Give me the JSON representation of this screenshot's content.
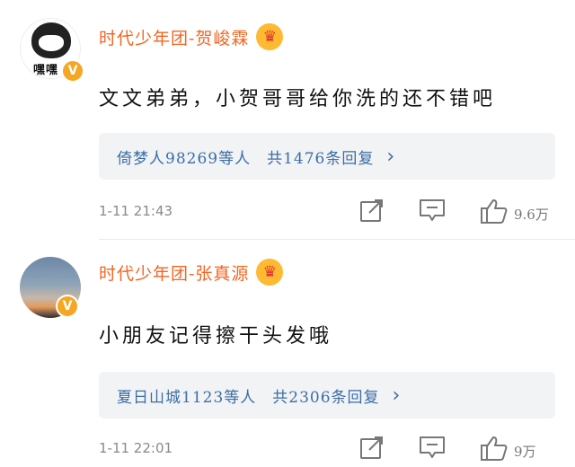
{
  "comments": [
    {
      "username": "时代少年团-贺峻霖",
      "avatar_text": "嘿嘿",
      "verified_badge": "V",
      "text": "文文弟弟，小贺哥哥给你洗的还不错吧",
      "reply_by": "倚梦人98269等人",
      "reply_count": "共1476条回复",
      "time": "1-11 21:43",
      "likes": "9.6万"
    },
    {
      "username": "时代少年团-张真源",
      "verified_badge": "V",
      "text": "小朋友记得擦干头发哦",
      "reply_by": "夏日山城1123等人",
      "reply_count": "共2306条回复",
      "time": "1-11 22:01",
      "likes": "9万"
    }
  ],
  "icons": {
    "crown": "crown-icon",
    "chevron": "chevron-right-icon",
    "share": "share-icon",
    "comment": "comment-icon",
    "like": "thumbs-up-icon"
  },
  "colors": {
    "username": "#f26522",
    "reply_link": "#3b6ea5",
    "crown_bg": "#ffb932",
    "badge": "#f5a623"
  }
}
